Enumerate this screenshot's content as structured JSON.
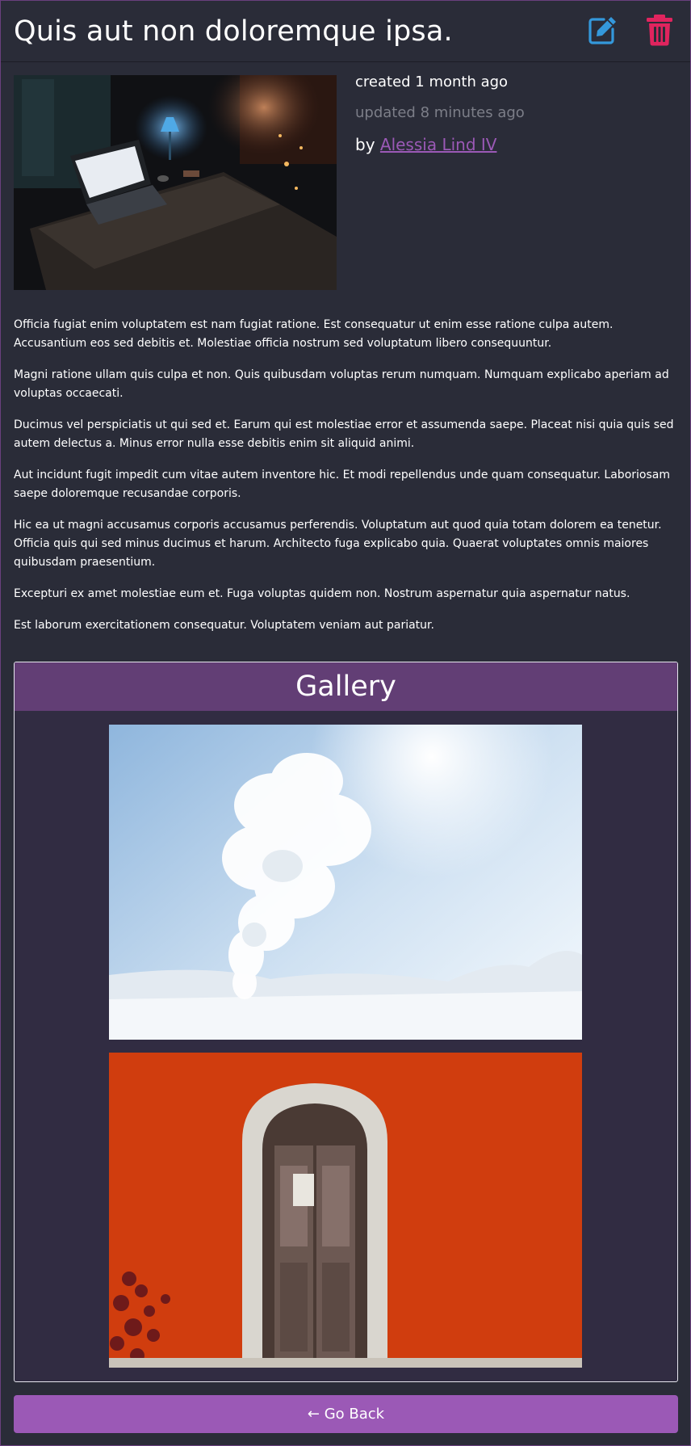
{
  "post": {
    "title": "Quis aut non doloremque ipsa.",
    "created": "created 1 month ago",
    "updated": "updated 8 minutes ago",
    "by_prefix": "by",
    "author": "Alessia Lind IV"
  },
  "actions": {
    "edit_icon": "edit-icon",
    "delete_icon": "trash-icon"
  },
  "content": {
    "paragraphs": [
      "Officia fugiat enim voluptatem est nam fugiat ratione. Est consequatur ut enim esse ratione culpa autem. Accusantium eos sed debitis et. Molestiae officia nostrum sed voluptatum libero consequuntur.",
      "Magni ratione ullam quis culpa et non. Quis quibusdam voluptas rerum numquam. Numquam explicabo aperiam ad voluptas occaecati.",
      "Ducimus vel perspiciatis ut qui sed et. Earum qui est molestiae error et assumenda saepe. Placeat nisi quia quis sed autem delectus a. Minus error nulla esse debitis enim sit aliquid animi.",
      "Aut incidunt fugit impedit cum vitae autem inventore hic. Et modi repellendus unde quam consequatur. Laboriosam saepe doloremque recusandae corporis.",
      "Hic ea ut magni accusamus corporis accusamus perferendis. Voluptatum aut quod quia totam dolorem ea tenetur. Officia quis qui sed minus ducimus et harum. Architecto fuga explicabo quia. Quaerat voluptates omnis maiores quibusdam praesentium.",
      "Excepturi ex amet molestiae eum et. Fuga voluptas quidem non. Nostrum aspernatur quia aspernatur natus.",
      "Est laborum exercitationem consequatur. Voluptatem veniam aut pariatur."
    ]
  },
  "gallery": {
    "title": "Gallery"
  },
  "back_button": {
    "label": "← Go Back"
  },
  "colors": {
    "background": "#2a2c38",
    "accent_purple": "#9b59b6",
    "gallery_header": "#623e75",
    "edit_blue": "#3498db",
    "delete_pink": "#e0245e"
  }
}
